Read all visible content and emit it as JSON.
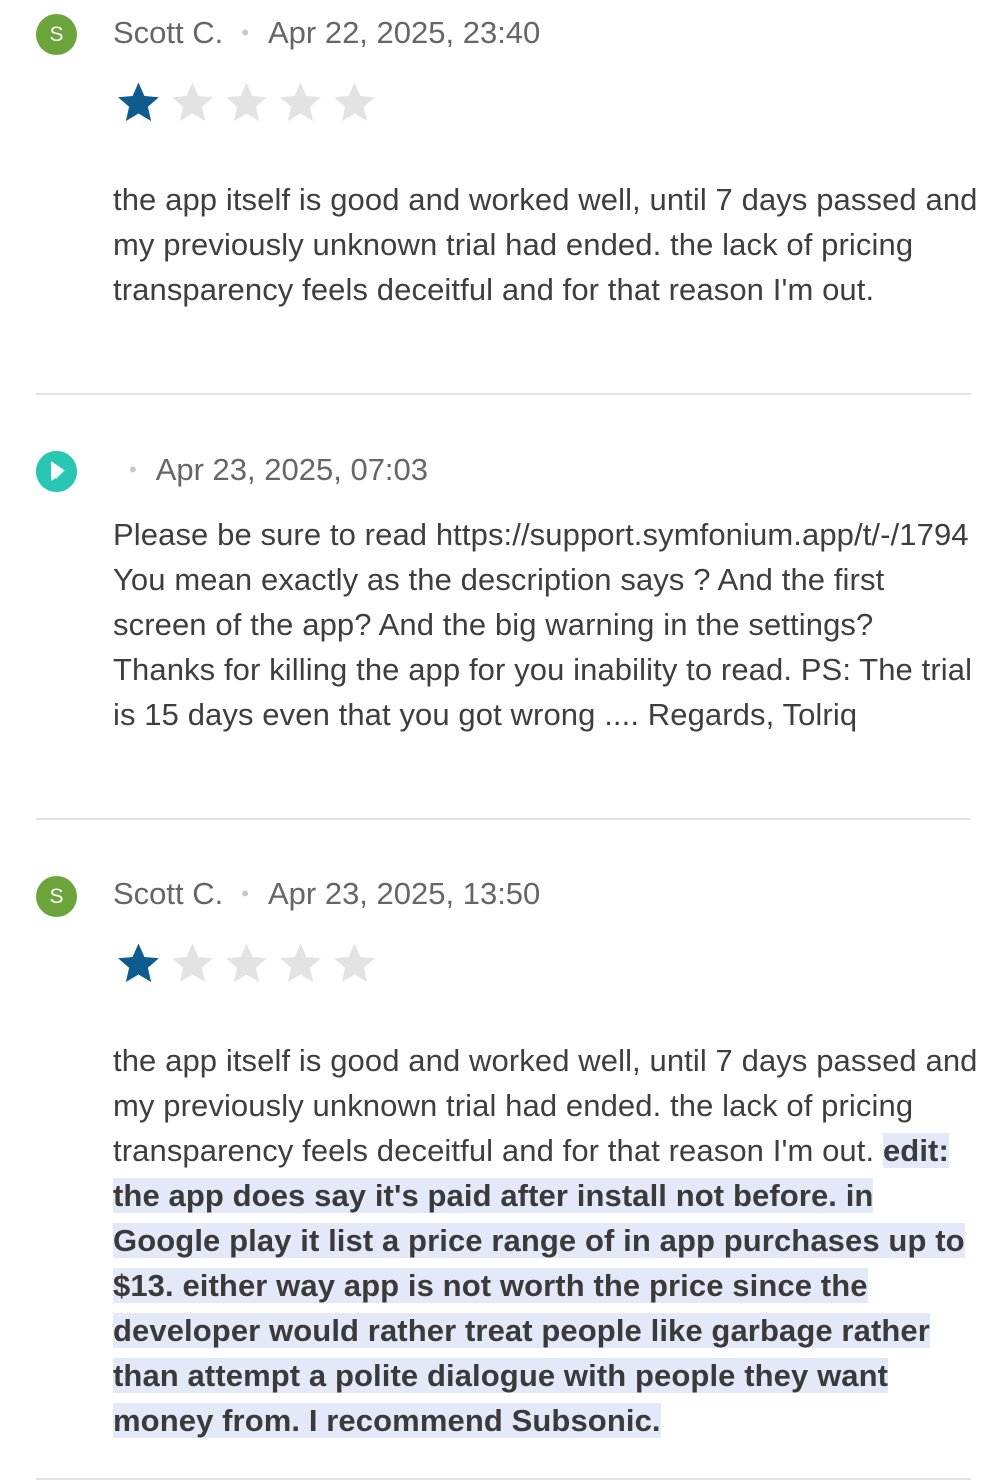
{
  "reviews": [
    {
      "avatar_letter": "S",
      "author": "Scott C.",
      "date": "Apr 22, 2025, 23:40",
      "rating": 1,
      "max_rating": 5,
      "text": "the app itself is good and worked well, until 7 days passed and my previously unknown trial had ended. the lack of pricing transparency feels deceitful and for that reason I'm out."
    },
    {
      "author": "",
      "date": "Apr 23, 2025, 07:03",
      "text": "Please be sure to read https://support.symfonium.app/t/-/1794 You mean exactly as the description says ? And the first screen of the app? And the big warning in the settings? Thanks for killing the app for you inability to read. PS: The trial is 15 days even that you got wrong .... Regards, Tolriq"
    },
    {
      "avatar_letter": "S",
      "author": "Scott C.",
      "date": "Apr 23, 2025, 13:50",
      "rating": 1,
      "max_rating": 5,
      "text": "the app itself is good and worked well, until 7 days passed and my previously unknown trial had ended. the lack of pricing transparency feels deceitful and for that reason I'm out.",
      "edit_text": "edit: the app does say it's paid after install not before. in Google play it list a price range of in app purchases up to $13. either way app is not worth the price since the developer would rather treat people like garbage rather than attempt a polite dialogue with people they want money from. I recommend Subsonic."
    }
  ],
  "colors": {
    "star_filled": "#0e5c8f",
    "star_empty": "#e3e3e3",
    "highlight": "#e3e9f8",
    "user_avatar": "#6aa43a",
    "dev_avatar": "#28c7b3"
  }
}
